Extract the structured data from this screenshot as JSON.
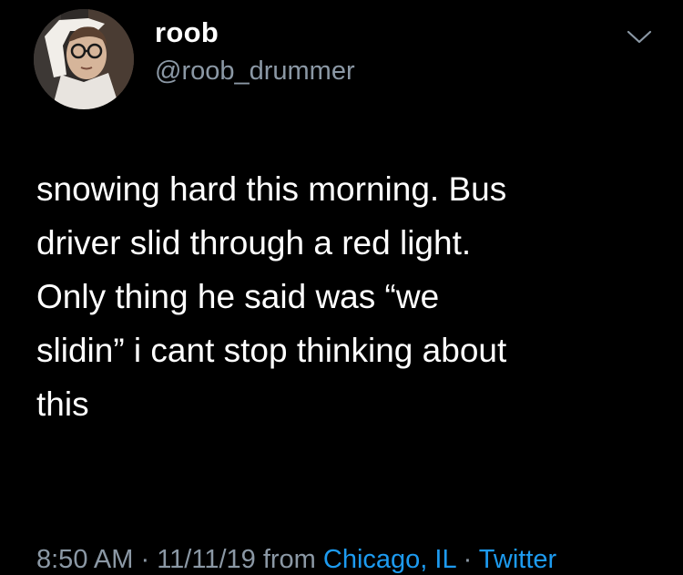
{
  "author": {
    "display_name": "roob",
    "handle": "@roob_drummer"
  },
  "tweet": {
    "lines": [
      "snowing hard this morning. Bus",
      "driver slid through a red light.",
      "Only thing he said was “we",
      "slidin” i cant stop thinking about",
      "this"
    ]
  },
  "meta": {
    "time": "8:50 AM",
    "separator_1": " · ",
    "date": "11/11/19",
    "from_label": " from ",
    "location": "Chicago, IL",
    "separator_2": " · ",
    "source": "Twitter"
  },
  "icons": {
    "menu": "chevron-down-icon"
  },
  "colors": {
    "background": "#000000",
    "text": "#ffffff",
    "secondary_text": "#8b98a5",
    "link": "#1d9bf0"
  }
}
